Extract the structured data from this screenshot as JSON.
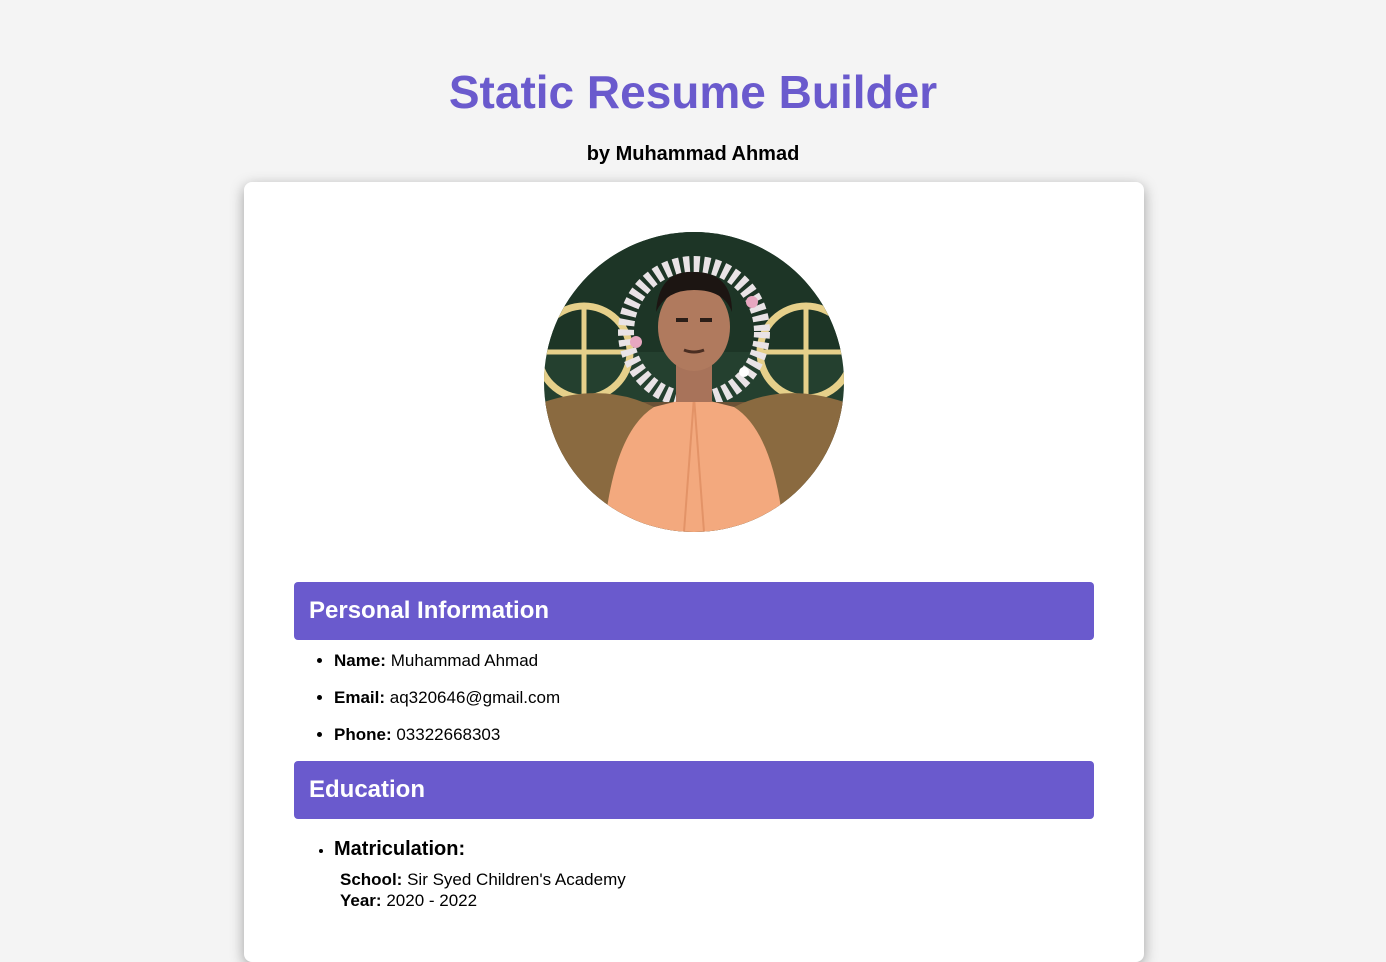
{
  "header": {
    "title": "Static Resume Builder",
    "subtitle": "by Muhammad Ahmad"
  },
  "profile": {
    "photo_icon": "profile-photo"
  },
  "personal": {
    "heading": "Personal Information",
    "name_label": "Name:",
    "name_value": "Muhammad Ahmad",
    "email_label": "Email:",
    "email_value": "aq320646@gmail.com",
    "phone_label": "Phone:",
    "phone_value": "03322668303"
  },
  "education": {
    "heading": "Education",
    "items": [
      {
        "title": "Matriculation:",
        "school_label": "School:",
        "school_value": "Sir Syed Children's Academy",
        "year_label": "Year:",
        "year_value": "2020 - 2022"
      }
    ]
  },
  "colors": {
    "accent": "#6a5acd",
    "background": "#f4f4f4",
    "card": "#ffffff"
  }
}
